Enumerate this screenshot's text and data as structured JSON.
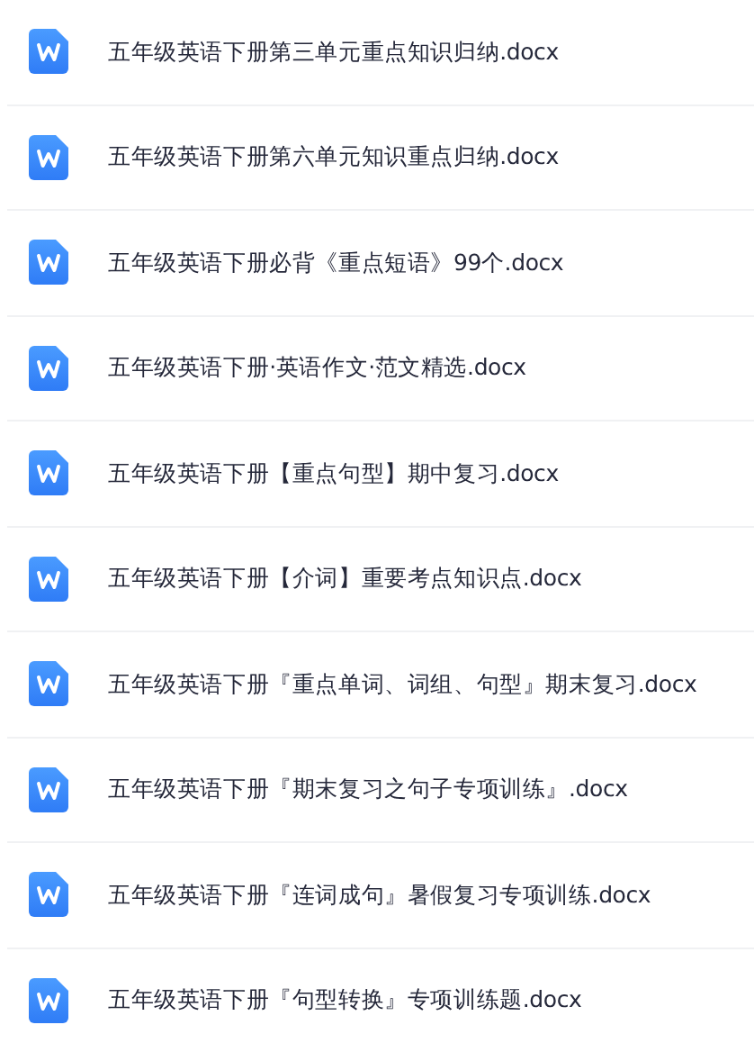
{
  "files": [
    {
      "name": "五年级英语下册第三单元重点知识归纳.docx"
    },
    {
      "name": "五年级英语下册第六单元知识重点归纳.docx"
    },
    {
      "name": "五年级英语下册必背《重点短语》99个.docx"
    },
    {
      "name": "五年级英语下册·英语作文·范文精选.docx"
    },
    {
      "name": "五年级英语下册【重点句型】期中复习.docx"
    },
    {
      "name": "五年级英语下册【介词】重要考点知识点.docx"
    },
    {
      "name": "五年级英语下册『重点单词、词组、句型』期末复习.docx"
    },
    {
      "name": "五年级英语下册『期末复习之句子专项训练』.docx"
    },
    {
      "name": "五年级英语下册『连词成句』暑假复习专项训练.docx"
    },
    {
      "name": "五年级英语下册『句型转换』专项训练题.docx"
    }
  ]
}
